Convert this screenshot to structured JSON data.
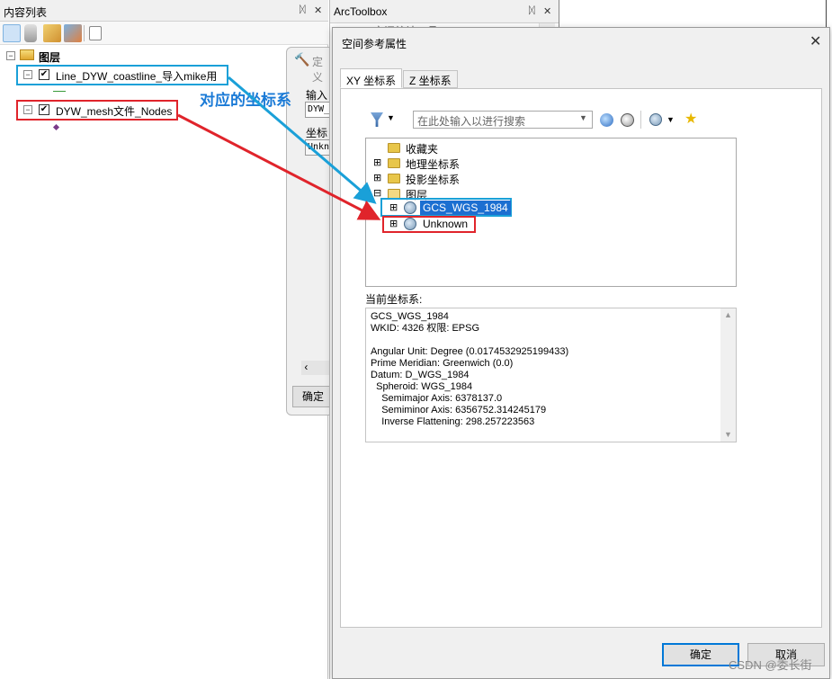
{
  "toc": {
    "title": "内容列表",
    "pin": "ᛞ",
    "close": "✕",
    "root_layer": "图层",
    "layers": [
      {
        "name": "Line_DYW_coastline_导入mike用",
        "checked": "✔",
        "expander": "⊟"
      },
      {
        "name": "DYW_mesh文件_Nodes",
        "checked": "✔",
        "expander": "⊟"
      }
    ]
  },
  "mid_dialog": {
    "title": "定义",
    "field1_label": "输入数",
    "field1_value": "DYW_m",
    "field2_label": "坐标系",
    "field2_value": "Unkno",
    "ok_label": "确定"
  },
  "toolbox": {
    "title": "ArcToolbox",
    "pin": "ᛞ",
    "close": "✕",
    "item": "空间统计工具"
  },
  "dialog": {
    "title": "空间参考属性",
    "close": "✕",
    "tabs": [
      "XY 坐标系",
      "Z 坐标系"
    ],
    "search_placeholder": "在此处输入以进行搜索",
    "tree": [
      {
        "label": "收藏夹"
      },
      {
        "label": "地理坐标系",
        "expander": "⊞"
      },
      {
        "label": "投影坐标系",
        "expander": "⊞"
      },
      {
        "label": "图层",
        "expander": "⊟"
      },
      {
        "label": "GCS_WGS_1984",
        "expander": "⊞"
      },
      {
        "label": "Unknown",
        "expander": "⊞"
      }
    ],
    "current_label": "当前坐标系:",
    "current_lines": [
      "GCS_WGS_1984",
      "WKID: 4326 权限: EPSG",
      "",
      "Angular Unit: Degree (0.0174532925199433)",
      "Prime Meridian: Greenwich (0.0)",
      "Datum: D_WGS_1984",
      "  Spheroid: WGS_1984",
      "    Semimajor Axis: 6378137.0",
      "    Semiminor Axis: 6356752.314245179",
      "    Inverse Flattening: 298.257223563"
    ],
    "ok_label": "确定",
    "cancel_label": "取消"
  },
  "annotation": "对应的坐标系",
  "watermark": "CSDN @委长街",
  "colors": {
    "blue_box": "#1aa0d8",
    "red_box": "#e0242b",
    "selection": "#1c6fd1"
  }
}
